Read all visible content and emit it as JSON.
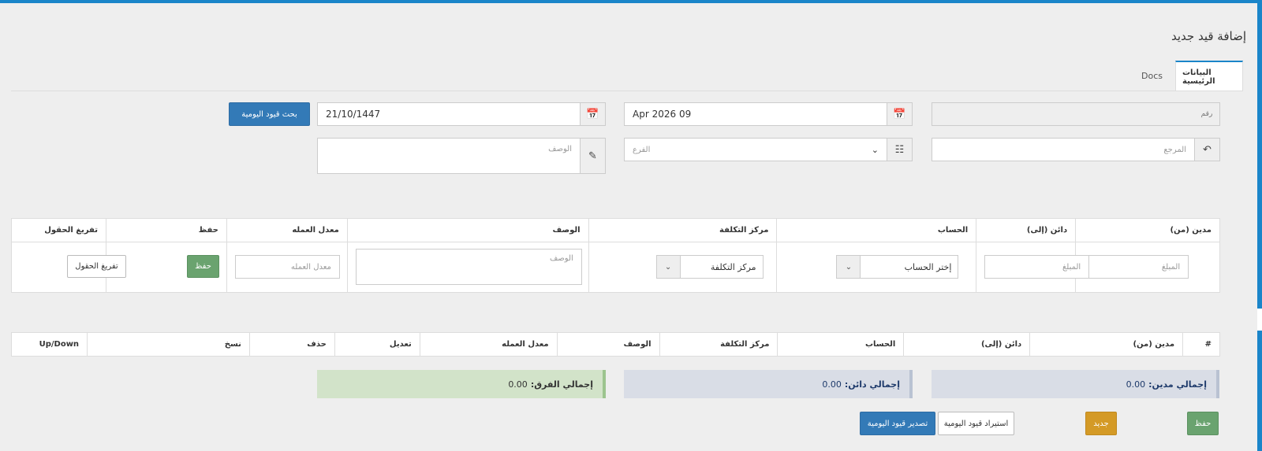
{
  "page": {
    "title": "إضافة قيد جديد"
  },
  "tabs": [
    {
      "label": "البيانات الرئيسية",
      "active": true
    },
    {
      "label": "Docs",
      "active": false
    }
  ],
  "form": {
    "number_placeholder": "رقم",
    "date_value": "09 Apr 2026",
    "hijri_date_value": "21/10/1447",
    "search_button": "بحث قيود اليومية",
    "reference_placeholder": "المرجع",
    "branch_placeholder": "الفرع",
    "description_placeholder": "الوصف"
  },
  "entry_table": {
    "headers": [
      "مدين (من)",
      "دائن (إلى)",
      "الحساب",
      "مركز التكلفة",
      "الوصف",
      "معدل العمله",
      "حفظ",
      "تفريغ الحقول"
    ],
    "debit_placeholder": "المبلغ",
    "credit_placeholder": "المبلغ",
    "account_select": "إختر الحساب",
    "cost_center_select": "مركز التكلفة",
    "description_placeholder": "الوصف",
    "rate_placeholder": "معدل العمله",
    "save_button": "حفظ",
    "clear_button": "تفريغ الحقول"
  },
  "list_table": {
    "headers": [
      "#",
      "مدين (من)",
      "دائن (إلى)",
      "الحساب",
      "مركز التكلفة",
      "الوصف",
      "معدل العمله",
      "تعديل",
      "حذف",
      "نسخ",
      "Up/Down"
    ]
  },
  "totals": {
    "debit_label": "إجمالي مدين:",
    "debit_value": "0.00",
    "credit_label": "إجمالي دائن:",
    "credit_value": "0.00",
    "diff_label": "إجمالي الفرق:",
    "diff_value": "0.00"
  },
  "footer": {
    "save": "حفظ",
    "new": "جديد",
    "import": "استيراد قيود اليومية",
    "export": "تصدير قيود اليومية"
  },
  "colors": {
    "accent": "#1a85c9",
    "primary": "#337ab7",
    "success": "#6aa36f",
    "warning": "#d49a26"
  },
  "icons": [
    "calendar-icon",
    "sitemap-icon",
    "undo-icon",
    "edit-icon",
    "chevron-down-icon"
  ]
}
